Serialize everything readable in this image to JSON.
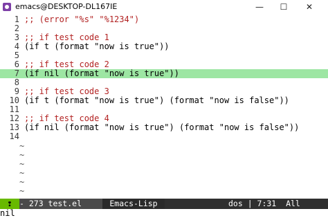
{
  "window": {
    "title": "emacs@DESKTOP-DL167IE"
  },
  "lines": [
    {
      "n": "1",
      "text": ";; (error \"%s\" \"%1234\")"
    },
    {
      "n": "2",
      "text": ""
    },
    {
      "n": "3",
      "text": ";; if test code 1"
    },
    {
      "n": "4",
      "text": "(if t (format \"now is true\"))"
    },
    {
      "n": "5",
      "text": ""
    },
    {
      "n": "6",
      "text": ";; if test code 2"
    },
    {
      "n": "7",
      "text": "(if nil (format \"now is true\"))"
    },
    {
      "n": "8",
      "text": ""
    },
    {
      "n": "9",
      "text": ";; if test code 3"
    },
    {
      "n": "10",
      "text": "(if t (format \"now is true\") (format \"now is false\"))"
    },
    {
      "n": "11",
      "text": ""
    },
    {
      "n": "12",
      "text": ";; if test code 4"
    },
    {
      "n": "13",
      "text": "(if nil (format \"now is true\") (format \"now is false\"))"
    },
    {
      "n": "14",
      "text": ""
    }
  ],
  "modeline": {
    "left": "- 273 test.el",
    "mode": "Emacs-Lisp",
    "right": "dos | 7:31  All"
  },
  "minibuffer": "nil"
}
